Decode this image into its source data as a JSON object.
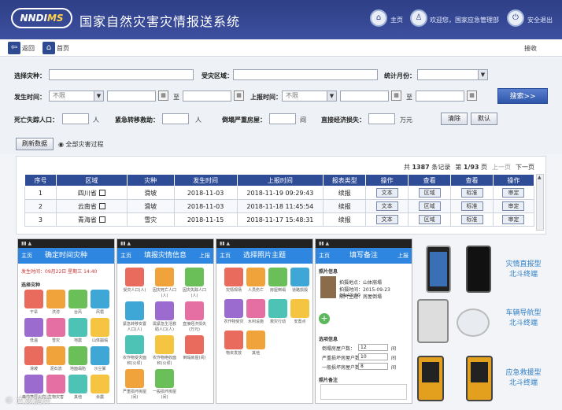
{
  "header": {
    "logo_main": "NNDI",
    "logo_accent": "MS",
    "title": "国家自然灾害灾情报送系统",
    "home_label": "主页",
    "welcome_label": "欢迎您，国家应急管理部",
    "logout_label": "安全退出",
    "bg_color": "#2e3f86"
  },
  "nav": {
    "back_label": "返回",
    "home_label": "首页",
    "right_text": "接收"
  },
  "filters": {
    "disaster_type_label": "选择灾种：",
    "region_label": "受灾区域：",
    "stat_month_label": "统计月份：",
    "occur_time_label": "发生时间：",
    "occur_time_value": "不限",
    "to_label": "至",
    "report_time_label": "上报时间：",
    "report_time_value": "不限",
    "search_button": "搜索>>",
    "deaths_label": "死亡失踪人口：",
    "deaths_unit": "人",
    "relocated_label": "紧急转移救助：",
    "relocated_unit": "人",
    "collapsed_label": "倒塌严重房屋：",
    "collapsed_unit": "间",
    "loss_label": "直接经济损失：",
    "loss_unit": "万元",
    "clear_button": "清除",
    "default_button": "默认",
    "refresh_button": "刷新数据",
    "all_process_label": "全部灾害过程"
  },
  "pagination": {
    "total_prefix": "共",
    "total_count": "1387",
    "records_suffix": "条记录",
    "page_prefix": "第",
    "page_value": "1/93",
    "page_suffix": "页",
    "first": "上一页",
    "next": "下一页"
  },
  "table": {
    "headers": [
      "序号",
      "区域",
      "灾种",
      "发生时间",
      "上报时间",
      "报表类型",
      "操作",
      "查看",
      "查看",
      "操作"
    ],
    "rows": [
      {
        "no": "1",
        "region": "四川省",
        "type": "滑坡",
        "occur": "2018-11-03",
        "report": "2018-11-19 09:29:43",
        "kind": "续报",
        "op1": "文本",
        "view1": "区域",
        "view2": "标准",
        "op2": "审定"
      },
      {
        "no": "2",
        "region": "云南省",
        "type": "滑坡",
        "occur": "2018-11-03",
        "report": "2018-11-18 11:45:54",
        "kind": "续报",
        "op1": "文本",
        "view1": "区域",
        "view2": "标准",
        "op2": "审定"
      },
      {
        "no": "3",
        "region": "青海省",
        "type": "雪灾",
        "occur": "2018-11-15",
        "report": "2018-11-17 15:48:31",
        "kind": "续报",
        "op1": "文本",
        "view1": "区域",
        "view2": "标准",
        "op2": "审定"
      }
    ]
  },
  "phones": [
    {
      "title": "确定时间灾种",
      "left": "主页",
      "right": "",
      "line1": "发生时间：09月22日 星期三 14:40",
      "line2": "选择灾种"
    },
    {
      "title": "填报灾情信息",
      "left": "主页",
      "right": "上报"
    },
    {
      "title": "选择照片主题",
      "left": "主页",
      "right": ""
    },
    {
      "title": "填写备注",
      "left": "主页",
      "right": "上报"
    }
  ],
  "phone1_tiles": [
    "干旱",
    "洪涝",
    "台风",
    "风雹",
    "低温",
    "雪灾",
    "地震",
    "山体崩塌",
    "滑坡",
    "泥石流",
    "地面塌陷",
    "沙尘暴",
    "森林草原火灾",
    "生物灾害",
    "其他",
    "余震"
  ],
  "phone2_tiles": [
    "受灾人口(人)",
    "因灾死亡人口(人)",
    "因灾失踪人口(人)",
    "紧急转移安置人口(人)",
    "需紧急生活救助人口(人)",
    "直接经济损失(万元)",
    "农作物受灾面积(公顷)",
    "农作物绝收面积(公顷)",
    "倒塌房屋(间)",
    "严重损坏房屋(间)",
    "一般损坏房屋(间)"
  ],
  "phone3_tiles": [
    "灾情现场",
    "人员伤亡",
    "房屋倒塌",
    "道路损毁",
    "农作物受灾",
    "水利设施",
    "救灾行动",
    "安置点",
    "物资发放",
    "其他"
  ],
  "phone4": {
    "section": "照片信息",
    "items": [
      "拍摄地点：山体崩塌",
      "拍摄时间：2015-09-23 14:43:00",
      "照片主题：房屋倒塌"
    ],
    "extra_title": "选项信息",
    "fields": [
      {
        "label": "倒塌房屋户数：",
        "value": "12",
        "unit": "间"
      },
      {
        "label": "严重损坏房屋户数：",
        "value": "10",
        "unit": "间"
      },
      {
        "label": "一般损坏房屋户数：",
        "value": "8",
        "unit": "间"
      }
    ],
    "note_label": "照片备注"
  },
  "devices": [
    {
      "line1": "灾情直报型",
      "line2": "北斗终端"
    },
    {
      "line1": "车辆导航型",
      "line2": "北斗终端"
    },
    {
      "line1": "应急救援型",
      "line2": "北斗终端"
    }
  ],
  "watermark": "大数据界"
}
